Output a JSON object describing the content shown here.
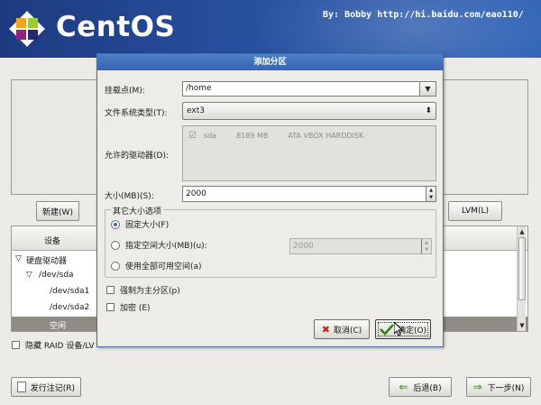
{
  "header": {
    "brand": "CentOS",
    "credit": "By: Bobby http://hi.baidu.com/eao110/"
  },
  "page": {
    "new_button": "新建(W)",
    "lvm_button": "LVM(L)",
    "table": {
      "column_device": "设备",
      "rows": [
        {
          "label": "硬盘驱动器",
          "indent": 0,
          "expander": "▽"
        },
        {
          "label": "/dev/sda",
          "indent": 1,
          "expander": "▽"
        },
        {
          "label": "/dev/sda1",
          "indent": 2,
          "expander": ""
        },
        {
          "label": "/dev/sda2",
          "indent": 2,
          "expander": ""
        },
        {
          "label": "空闲",
          "indent": 2,
          "expander": "",
          "selected": true
        }
      ]
    },
    "hide_raid_label": "隐藏 RAID 设备/LV",
    "release_notes_button": "发行注记(R)",
    "back_button": "后退(B)",
    "next_button": "下一步(N)"
  },
  "dialog": {
    "title": "添加分区",
    "mount_point_label": "挂载点(M):",
    "mount_point_value": "/home",
    "fs_type_label": "文件系统类型(T):",
    "fs_type_value": "ext3",
    "drives_label": "允许的驱动器(D):",
    "drive": {
      "name": "sda",
      "size": "8189 MB",
      "model": "ATA VBOX HARDDISK",
      "checked": true
    },
    "size_label": "大小(MB)(S):",
    "size_value": "2000",
    "options_legend": "其它大小选项",
    "opt_fixed": "固定大小(F)",
    "opt_fill_upto": "指定空间大小(MB)(u):",
    "opt_fill_upto_value": "2000",
    "opt_fill_all": "使用全部可用空间(a)",
    "force_primary": "强制为主分区(p)",
    "encrypt": "加密 (E)",
    "cancel_button": "取消(C)",
    "ok_button": "确定(O)"
  }
}
